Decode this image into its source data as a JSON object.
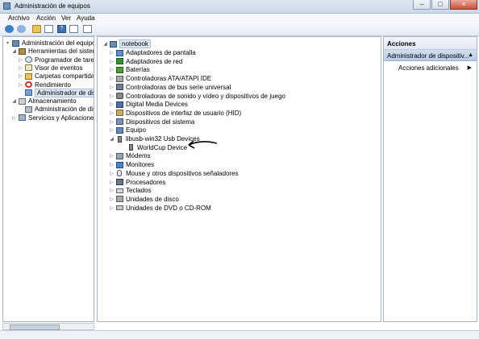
{
  "window": {
    "title": "Administración de equipos"
  },
  "menu": [
    "Archivo",
    "Acción",
    "Ver",
    "Ayuda"
  ],
  "left_tree": [
    {
      "label": "Administración del equipo (loc",
      "icon": "computer-icon",
      "expander": "▾",
      "indent": 0
    },
    {
      "label": "Herramientas del sistema",
      "icon": "tools-icon",
      "expander": "◢",
      "indent": 1
    },
    {
      "label": "Programador de tareas",
      "icon": "clock-icon",
      "expander": "▷",
      "indent": 2
    },
    {
      "label": "Visor de eventos",
      "icon": "event-log-icon",
      "expander": "▷",
      "indent": 2
    },
    {
      "label": "Carpetas compartidas",
      "icon": "shared-folder-icon",
      "expander": "▷",
      "indent": 2
    },
    {
      "label": "Rendimiento",
      "icon": "performance-icon",
      "expander": "▷",
      "indent": 2
    },
    {
      "label": "Administrador de dispo",
      "icon": "device-manager-icon",
      "expander": "",
      "indent": 2,
      "selected": true
    },
    {
      "label": "Almacenamiento",
      "icon": "storage-icon",
      "expander": "◢",
      "indent": 1
    },
    {
      "label": "Administración de disco",
      "icon": "disk-icon",
      "expander": "",
      "indent": 2
    },
    {
      "label": "Servicios y Aplicaciones",
      "icon": "services-icon",
      "expander": "▷",
      "indent": 1
    }
  ],
  "device_tree": {
    "root": "notebook",
    "items": [
      {
        "label": "Adaptadores de pantalla",
        "icon": "display-adapter-icon",
        "expander": "▷"
      },
      {
        "label": "Adaptadores de red",
        "icon": "network-adapter-icon",
        "expander": "▷"
      },
      {
        "label": "Baterías",
        "icon": "battery-icon",
        "expander": "▷"
      },
      {
        "label": "Controladoras ATA/ATAPI IDE",
        "icon": "ide-controller-icon",
        "expander": "▷"
      },
      {
        "label": "Controladoras de bus serie universal",
        "icon": "usb-controller-icon",
        "expander": "▷"
      },
      {
        "label": "Controladoras de sonido y vídeo y dispositivos de juego",
        "icon": "sound-icon",
        "expander": "▷"
      },
      {
        "label": "Digital Media Devices",
        "icon": "media-device-icon",
        "expander": "▷"
      },
      {
        "label": "Dispositivos de interfaz de usuario (HID)",
        "icon": "hid-icon",
        "expander": "▷"
      },
      {
        "label": "Dispositivos del sistema",
        "icon": "system-device-icon",
        "expander": "▷"
      },
      {
        "label": "Equipo",
        "icon": "computer-icon",
        "expander": "▷"
      },
      {
        "label": "libusb-win32 Usb Devices",
        "icon": "libusb-icon",
        "expander": "◢"
      },
      {
        "label": "WorldCup Device",
        "icon": "usb-device-icon",
        "expander": "",
        "child": true
      },
      {
        "label": "Módems",
        "icon": "modem-icon",
        "expander": "▷"
      },
      {
        "label": "Monitores",
        "icon": "monitor-icon",
        "expander": "▷"
      },
      {
        "label": "Mouse y otros dispositivos señaladores",
        "icon": "mouse-icon",
        "expander": "▷"
      },
      {
        "label": "Procesadores",
        "icon": "processor-icon",
        "expander": "▷"
      },
      {
        "label": "Teclados",
        "icon": "keyboard-icon",
        "expander": "▷"
      },
      {
        "label": "Unidades de disco",
        "icon": "disk-drive-icon",
        "expander": "▷"
      },
      {
        "label": "Unidades de DVD o CD-ROM",
        "icon": "dvd-drive-icon",
        "expander": "▷"
      }
    ]
  },
  "actions": {
    "header": "Acciones",
    "section": "Administrador de dispositiv...",
    "more": "Acciones adicionales"
  }
}
